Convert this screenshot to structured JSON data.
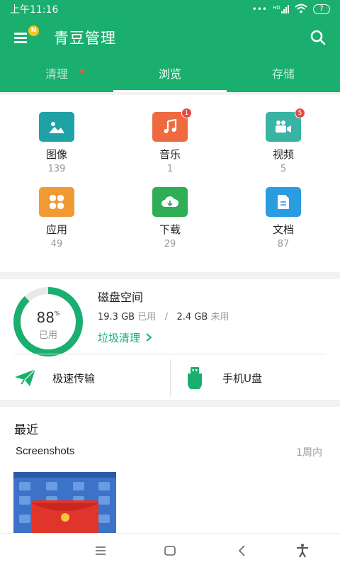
{
  "status_bar": {
    "time": "上午11:16",
    "network_hd": "HD",
    "battery": "7"
  },
  "app_bar": {
    "title": "青豆管理",
    "menu_badge": "N"
  },
  "tabs": [
    {
      "label": "清理",
      "has_dot": true
    },
    {
      "label": "浏览",
      "active": true
    },
    {
      "label": "存储"
    }
  ],
  "categories": [
    {
      "label": "图像",
      "count": "139",
      "color": "#1fa2a6",
      "icon": "image-icon"
    },
    {
      "label": "音乐",
      "count": "1",
      "color": "#ef6a3e",
      "icon": "music-icon",
      "badge": "1"
    },
    {
      "label": "视频",
      "count": "5",
      "color": "#39b3a3",
      "icon": "video-icon",
      "badge": "5"
    },
    {
      "label": "应用",
      "count": "49",
      "color": "#f09a35",
      "icon": "apps-icon"
    },
    {
      "label": "下载",
      "count": "29",
      "color": "#2fae55",
      "icon": "download-icon"
    },
    {
      "label": "文档",
      "count": "87",
      "color": "#2a9de0",
      "icon": "document-icon"
    }
  ],
  "disk": {
    "used_percent": "88",
    "percent_sign": "%",
    "used_label": "已用",
    "title": "磁盘空间",
    "used_size": "19.3 GB",
    "used_text": "已用",
    "separator": "/",
    "free_size": "2.4 GB",
    "free_text": "未用",
    "clean_link": "垃圾清理",
    "ring_fraction": 0.88
  },
  "tools": [
    {
      "label": "极速传输",
      "icon": "send-icon"
    },
    {
      "label": "手机U盘",
      "icon": "usb-drive-icon"
    }
  ],
  "recent": {
    "title": "最近",
    "folder": "Screenshots",
    "time": "1周内"
  },
  "colors": {
    "brand": "#1aae6f",
    "badge_red": "#e8483f"
  }
}
